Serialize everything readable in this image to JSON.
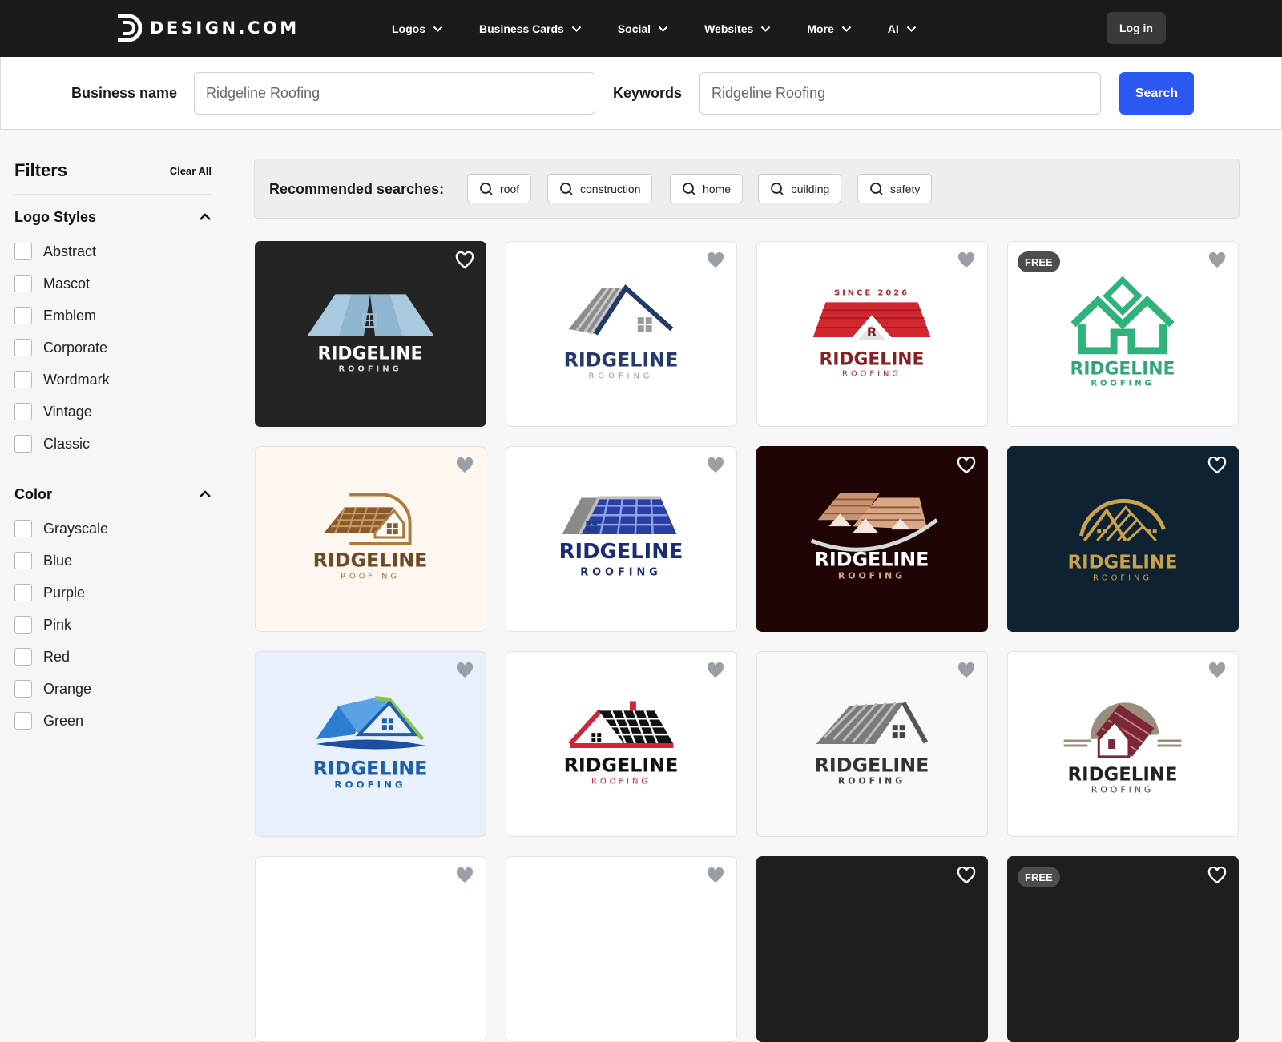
{
  "brand": {
    "name": "DESIGN.COM"
  },
  "nav": {
    "items": [
      {
        "label": "Logos"
      },
      {
        "label": "Business Cards"
      },
      {
        "label": "Social"
      },
      {
        "label": "Websites"
      },
      {
        "label": "More"
      },
      {
        "label": "AI"
      }
    ],
    "login_label": "Log in"
  },
  "search": {
    "business_label": "Business name",
    "business_value": "Ridgeline Roofing",
    "keywords_label": "Keywords",
    "keywords_value": "Ridgeline Roofing",
    "button_label": "Search"
  },
  "filters": {
    "title": "Filters",
    "clear_label": "Clear All",
    "styles": {
      "title": "Logo Styles",
      "options": [
        "Abstract",
        "Mascot",
        "Emblem",
        "Corporate",
        "Wordmark",
        "Vintage",
        "Classic"
      ]
    },
    "color": {
      "title": "Color",
      "options": [
        "Grayscale",
        "Blue",
        "Purple",
        "Pink",
        "Red",
        "Orange",
        "Green"
      ]
    }
  },
  "recommended": {
    "label": "Recommended searches:",
    "chips": [
      "roof",
      "construction",
      "home",
      "building",
      "safety"
    ]
  },
  "logo_text": {
    "name": "RIDGELINE",
    "sub": "ROOFING",
    "since": "SINCE 2026",
    "initial": "R"
  },
  "badges": {
    "free": "FREE"
  },
  "colors": {
    "accent": "#2c58f2",
    "nav_bg": "#1b1b1b"
  }
}
